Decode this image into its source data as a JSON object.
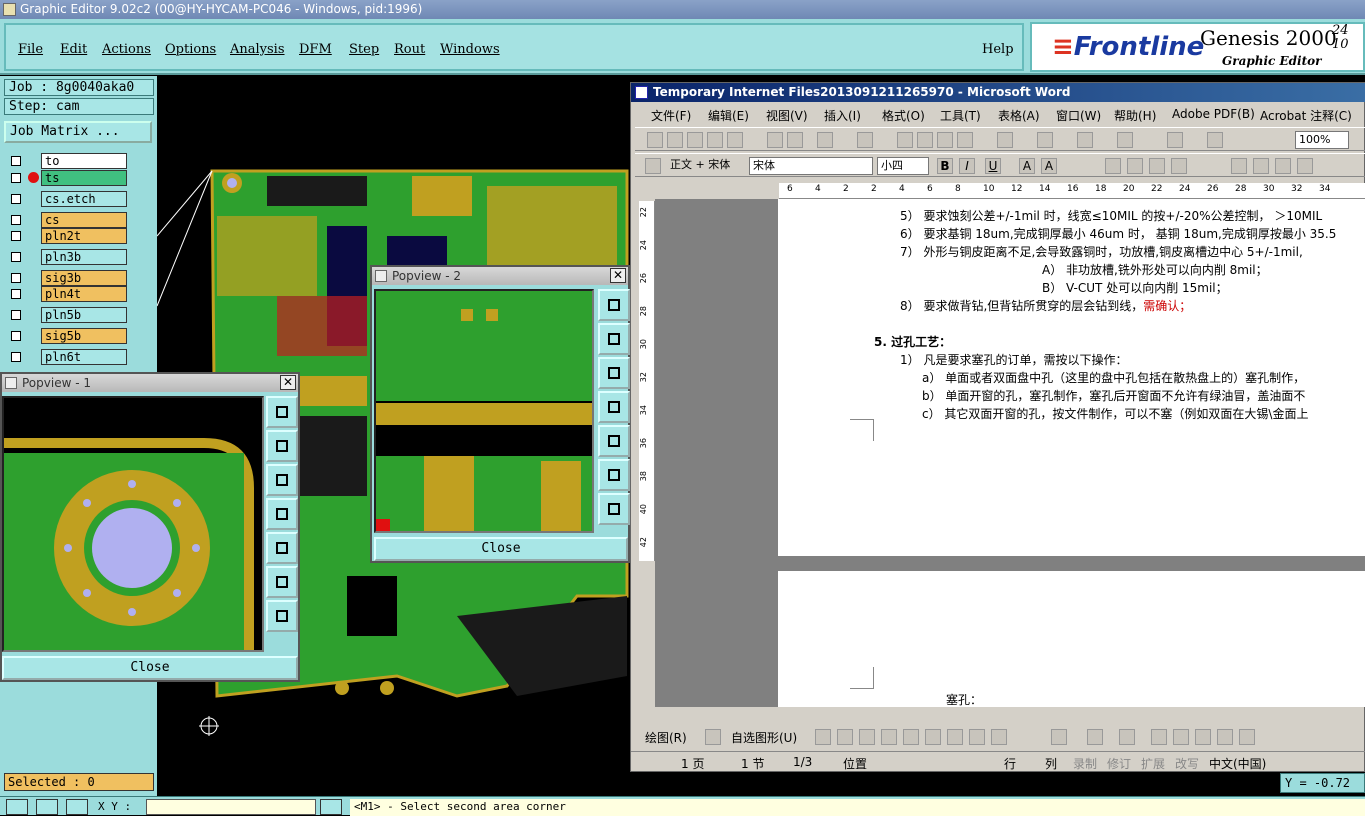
{
  "editor": {
    "title": "Graphic Editor 9.02c2 (00@HY-HYCAM-PC046 - Windows, pid:1996)",
    "menu": [
      "File",
      "Edit",
      "Actions",
      "Options",
      "Analysis",
      "DFM",
      "Step",
      "Rout",
      "Windows"
    ],
    "help": "Help",
    "brand": {
      "logo": "Frontline",
      "product": "Genesis 2000",
      "sub": "Graphic Editor",
      "version_top": "24",
      "version_bottom": "10"
    },
    "job": "Job : 8g0040aka0",
    "step": "Step: cam",
    "job_matrix": "Job Matrix ...",
    "layers": [
      {
        "name": "to",
        "color": "#ffffff"
      },
      {
        "name": "ts",
        "color": "#40c080",
        "marker": true
      },
      {
        "name": "cs.etch",
        "color": "#a8e6e6"
      },
      {
        "name": "cs",
        "color": "#f0c060"
      },
      {
        "name": "pln2t",
        "color": "#f0c060"
      },
      {
        "name": "pln3b",
        "color": "#a8e6e6"
      },
      {
        "name": "sig3b",
        "color": "#f0c060"
      },
      {
        "name": "pln4t",
        "color": "#f0c060"
      },
      {
        "name": "pln5b",
        "color": "#a8e6e6"
      },
      {
        "name": "sig5b",
        "color": "#f0c060"
      },
      {
        "name": "pln6t",
        "color": "#a8e6e6"
      }
    ],
    "selected": "Selected : 0",
    "xy_label": "X Y :",
    "prompt": "<M1> - Select second area corner",
    "y_readout": "Y = -0.72"
  },
  "popview1": {
    "title": "Popview - 1",
    "close": "Close"
  },
  "popview2": {
    "title": "Popview - 2",
    "close": "Close"
  },
  "word": {
    "title": "Temporary Internet Files2013091211265970 - Microsoft Word",
    "menu": [
      "文件(F)",
      "编辑(E)",
      "视图(V)",
      "插入(I)",
      "格式(O)",
      "工具(T)",
      "表格(A)",
      "窗口(W)",
      "帮助(H)",
      "Adobe PDF(B)",
      "Acrobat 注释(C)"
    ],
    "zoom": "100%",
    "style": "正文 + 宋体",
    "font": "宋体",
    "size": "小四",
    "ruler": [
      "6",
      "4",
      "2",
      "2",
      "4",
      "6",
      "8",
      "10",
      "12",
      "14",
      "16",
      "18",
      "20",
      "22",
      "24",
      "26",
      "28",
      "30",
      "32",
      "34"
    ],
    "vruler": [
      "22",
      "24",
      "26",
      "28",
      "30",
      "32",
      "34",
      "36",
      "38",
      "40",
      "42"
    ],
    "lines": [
      {
        "t": "5） 要求蚀刻公差+/-1mil 时，线宽≤10MIL 的按+/-20%公差控制， ＞10MIL"
      },
      {
        "t": "6） 要求基铜 18um,完成铜厚最小 46um 时， 基铜 18um,完成铜厚按最小 35.5"
      },
      {
        "t": "7） 外形与铜皮距离不足,会导致露铜时，功放槽,铜皮离槽边中心 5+/-1mil,"
      },
      {
        "t": "A） 非功放槽,铣外形处可以向内削 8mil；"
      },
      {
        "t": "B） V-CUT 处可以向内削 15mil；"
      },
      {
        "t": "8） 要求做背钻,但背钻所贯穿的层会钻到线，",
        "red": "需确认；"
      },
      {
        "t": "5.   过孔工艺："
      },
      {
        "t": "1） 凡是要求塞孔的订单，需按以下操作："
      },
      {
        "t": "a） 单面或者双面盘中孔（这里的盘中孔包括在散热盘上的）塞孔制作，"
      },
      {
        "t": "b） 单面开窗的孔，塞孔制作，塞孔后开窗面不允许有绿油冒，盖油面不"
      },
      {
        "t": "c） 其它双面开窗的孔，按文件制作，可以不塞（例如双面在大锡\\金面上"
      },
      {
        "t": "塞孔："
      }
    ],
    "draw_label": "绘图(R)",
    "autoshape": "自选图形(U)",
    "status": [
      "1 页",
      "1 节",
      "1/3",
      "位置",
      "行",
      "列",
      "录制",
      "修订",
      "扩展",
      "改写",
      "中文(中国)"
    ]
  },
  "colors": {
    "teal": "#9bdcdc",
    "pcb_green": "#2ea02e",
    "pcb_gold": "#c0a020",
    "pad_blue": "#b0b0f0"
  }
}
